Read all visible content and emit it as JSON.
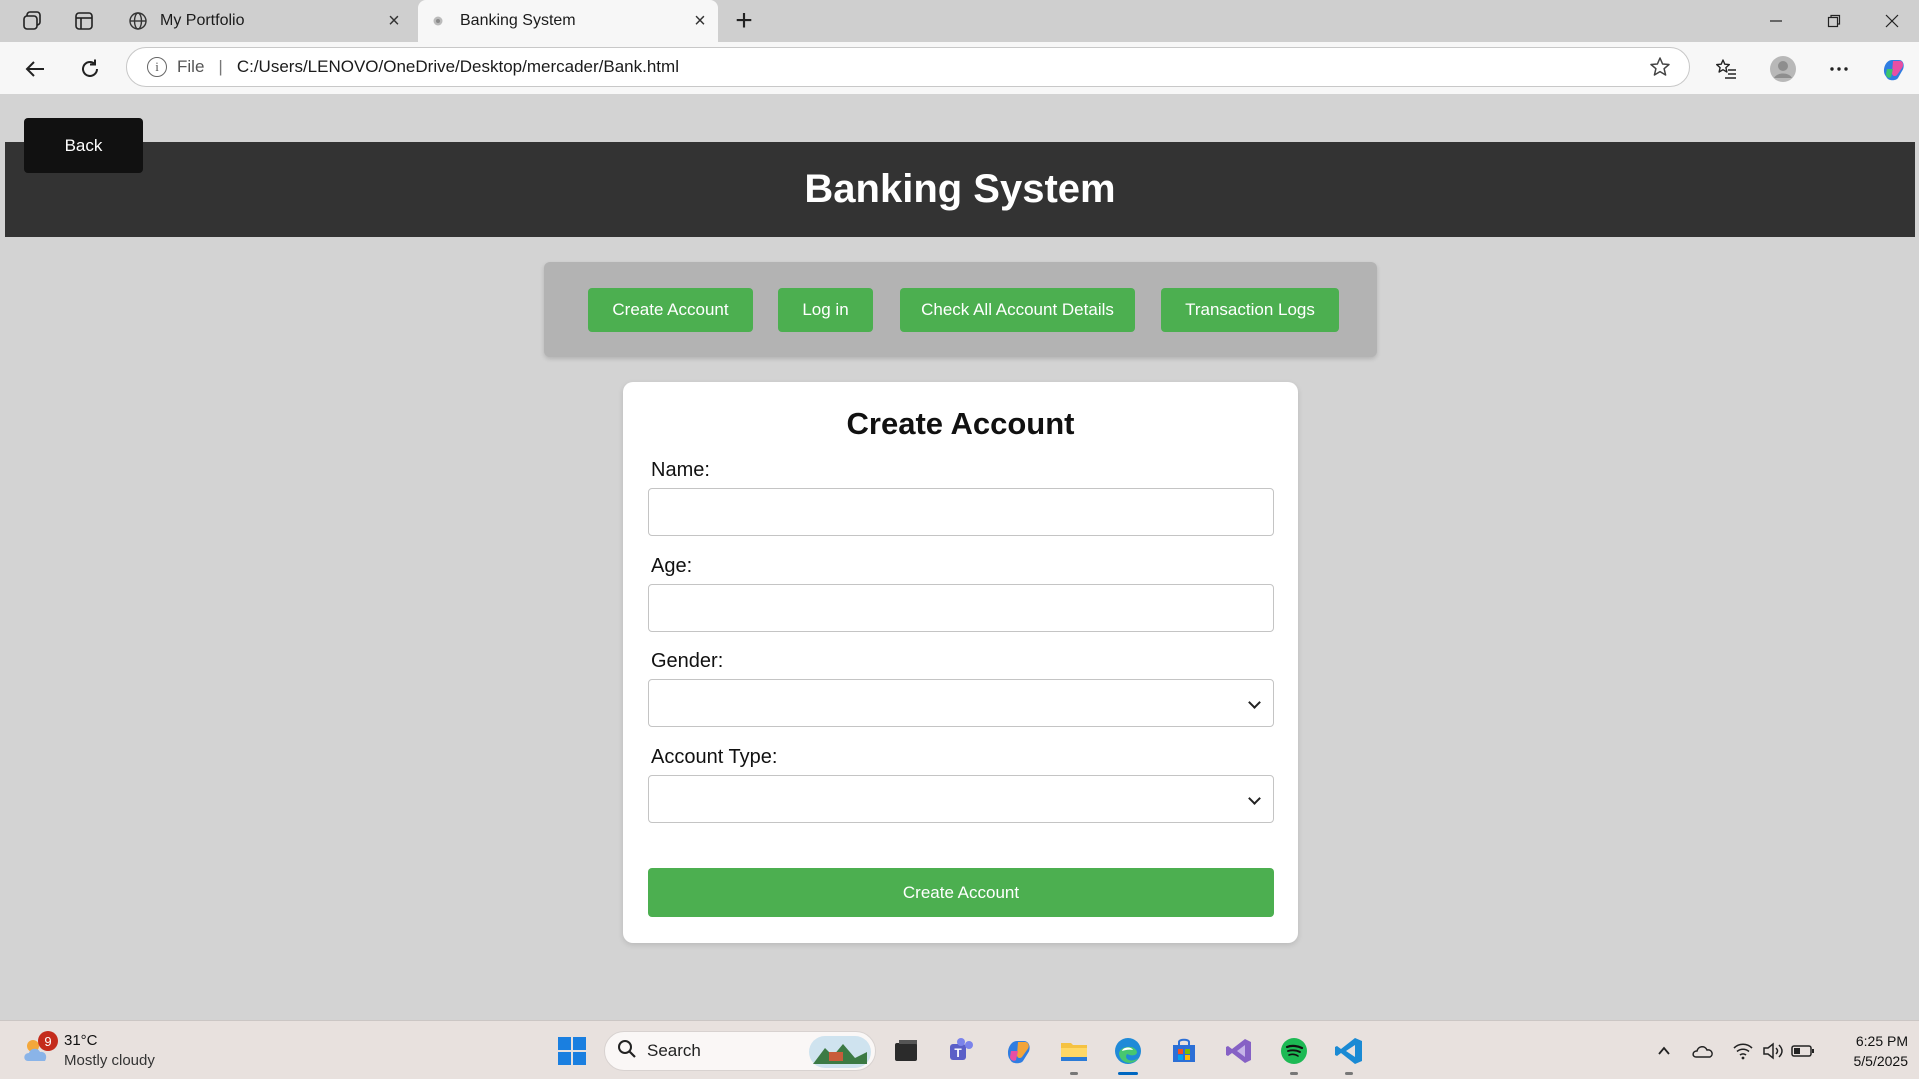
{
  "browser": {
    "tabs": [
      {
        "title": "My Portfolio",
        "active": false
      },
      {
        "title": "Banking System",
        "active": true
      }
    ],
    "address": {
      "scheme_label": "File",
      "url": "C:/Users/LENOVO/OneDrive/Desktop/mercader/Bank.html"
    }
  },
  "page": {
    "back_label": "Back",
    "title": "Banking System",
    "menu": [
      {
        "label": "Create Account"
      },
      {
        "label": "Log in"
      },
      {
        "label": "Check All Account Details"
      },
      {
        "label": "Transaction Logs"
      }
    ],
    "form": {
      "heading": "Create Account",
      "name_label": "Name:",
      "name_value": "",
      "age_label": "Age:",
      "age_value": "",
      "gender_label": "Gender:",
      "gender_value": "",
      "account_type_label": "Account Type:",
      "account_type_value": "",
      "submit_label": "Create Account"
    },
    "colors": {
      "accent_green": "#4caf50",
      "header_bg": "#333333",
      "page_bg": "#d3d3d3"
    }
  },
  "taskbar": {
    "weather": {
      "badge": "9",
      "temp": "31°C",
      "condition": "Mostly cloudy"
    },
    "search_label": "Search",
    "apps": [
      "task-view",
      "teams",
      "copilot",
      "file-explorer",
      "edge",
      "store",
      "visual-studio",
      "spotify",
      "vscode"
    ],
    "clock": {
      "time": "6:25 PM",
      "date": "5/5/2025"
    }
  }
}
